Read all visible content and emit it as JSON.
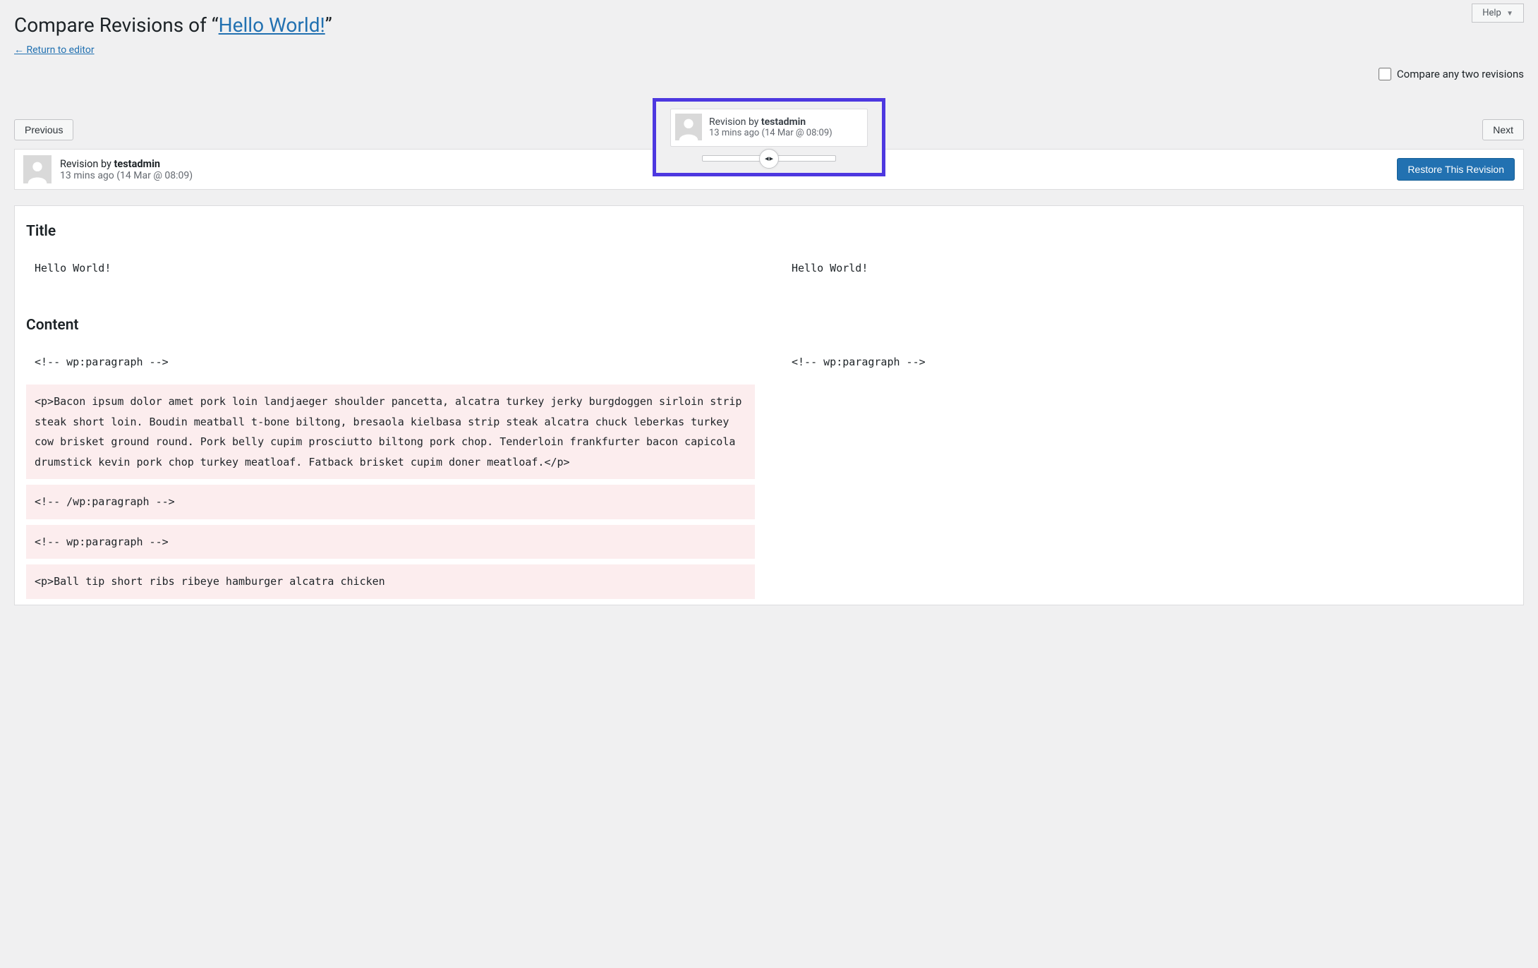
{
  "help": {
    "label": "Help"
  },
  "header": {
    "prefix": "Compare Revisions of “",
    "post_title": "Hello World!",
    "suffix": "”",
    "return_link": "← Return to editor"
  },
  "compare_toggle": {
    "label": "Compare any two revisions"
  },
  "nav": {
    "previous": "Previous",
    "next": "Next"
  },
  "tooltip": {
    "by_prefix": "Revision by ",
    "author": "testadmin",
    "time_rel": "13 mins ago",
    "time_abs": "(14 Mar @ 08:09)"
  },
  "revision_bar": {
    "by_prefix": "Revision by ",
    "author": "testadmin",
    "time_rel": "13 mins ago",
    "time_abs": "(14 Mar @ 08:09)",
    "restore_btn": "Restore This Revision"
  },
  "diff": {
    "title_heading": "Title",
    "title_left": "Hello World!",
    "title_right": "Hello World!",
    "content_heading": "Content",
    "rows": [
      {
        "left": "<!-- wp:paragraph -->",
        "right": "<!-- wp:paragraph -->",
        "changed": false
      },
      {
        "left": "<p>Bacon ipsum dolor amet pork loin landjaeger shoulder pancetta, alcatra turkey jerky burgdoggen sirloin strip steak short loin. Boudin meatball t-bone biltong, bresaola kielbasa strip steak alcatra chuck leberkas turkey cow brisket ground round. Pork belly cupim prosciutto biltong pork chop. Tenderloin frankfurter bacon capicola drumstick kevin pork chop turkey meatloaf. Fatback brisket cupim doner meatloaf.</p>",
        "right": "",
        "changed": true
      },
      {
        "left": "<!-- /wp:paragraph -->",
        "right": "",
        "changed": true
      },
      {
        "left": "<!-- wp:paragraph -->",
        "right": "",
        "changed": true
      },
      {
        "left": "<p>Ball tip short ribs ribeye hamburger alcatra chicken",
        "right": "",
        "changed": true
      }
    ]
  }
}
